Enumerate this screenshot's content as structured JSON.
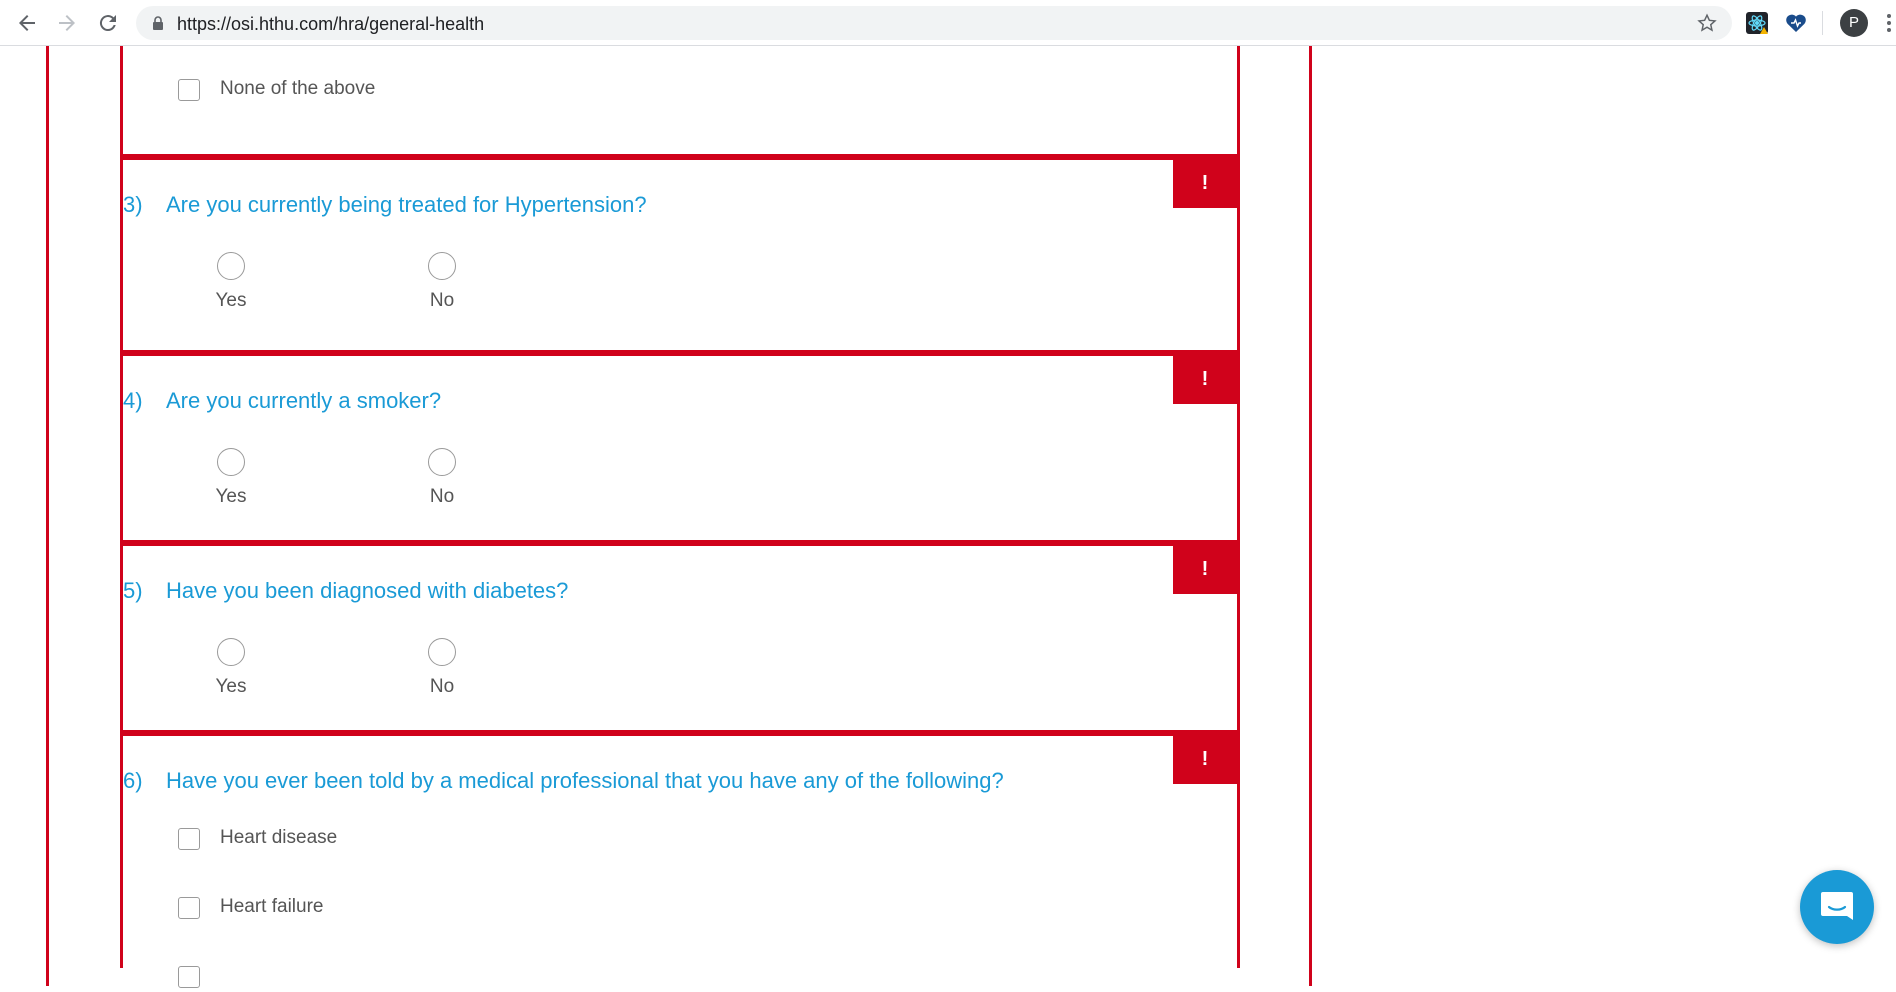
{
  "browser": {
    "url": "https://osi.hthu.com/hra/general-health",
    "avatar_letter": "P"
  },
  "colors": {
    "accent_red": "#d0021b",
    "question_blue": "#1a9ad6",
    "text_gray": "#555555"
  },
  "q2_tail": {
    "option_label": "None of the above"
  },
  "questions": [
    {
      "number": "3)",
      "text": "Are you currently being treated for Hypertension?",
      "flag": "!",
      "options": [
        "Yes",
        "No"
      ]
    },
    {
      "number": "4)",
      "text": "Are you currently a smoker?",
      "flag": "!",
      "options": [
        "Yes",
        "No"
      ]
    },
    {
      "number": "5)",
      "text": "Have you been diagnosed with diabetes?",
      "flag": "!",
      "options": [
        "Yes",
        "No"
      ]
    },
    {
      "number": "6)",
      "text": "Have you ever been told by a medical professional that you have any of the following?",
      "flag": "!",
      "options": [
        "Heart disease",
        "Heart failure"
      ]
    }
  ]
}
